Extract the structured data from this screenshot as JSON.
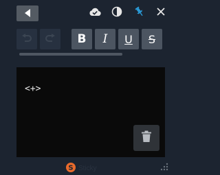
{
  "colors": {
    "background": "#1c2430",
    "accent": "#2a9bd8",
    "button_light": "#4c5561",
    "button_dark": "#273140",
    "editor_bg": "#0a0a0a",
    "logo_orange": "#e86a2b"
  },
  "topbar": {
    "icons": [
      "back-arrow-icon",
      "cloud-check-icon",
      "contrast-icon",
      "pin-icon",
      "close-icon"
    ]
  },
  "toolbar": {
    "undo_icon": "undo-icon",
    "redo_icon": "redo-icon",
    "bold_label": "B",
    "italic_label": "I",
    "underline_label": "U",
    "strikethrough_label": "S"
  },
  "editor": {
    "content": "<+>"
  },
  "footer": {
    "brand_label": "Sticky"
  }
}
